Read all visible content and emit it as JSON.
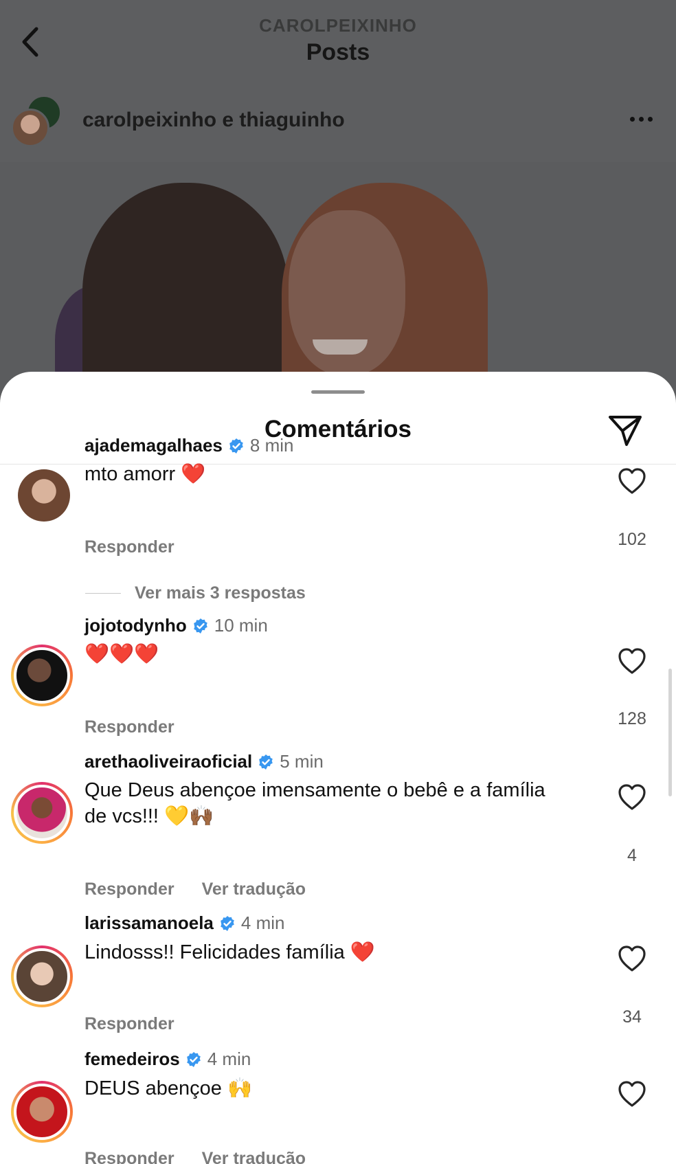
{
  "header": {
    "username": "CAROLPEIXINHO",
    "title": "Posts"
  },
  "post": {
    "authors": "carolpeixinho e thiaguinho"
  },
  "sheet": {
    "title": "Comentários"
  },
  "comments": [
    {
      "user": "ajademagalhaes",
      "time": "8 min",
      "text": "mto amorr",
      "emoji": "❤️",
      "reply_label": "Responder",
      "likes": "102",
      "more_replies": "Ver mais 3 respostas"
    },
    {
      "user": "jojotodynho",
      "time": "10 min",
      "text": "",
      "emoji": "❤️❤️❤️",
      "reply_label": "Responder",
      "likes": "128"
    },
    {
      "user": "arethaoliveiraoficial",
      "time": "5 min",
      "text": "Que Deus abençoe imensamente o bebê e a família de vcs!!!",
      "emoji": "💛🙌🏾",
      "reply_label": "Responder",
      "translate_label": "Ver tradução",
      "likes": "4"
    },
    {
      "user": "larissamanoela",
      "time": "4 min",
      "text": "Lindosss!! Felicidades família",
      "emoji": "❤️",
      "reply_label": "Responder",
      "likes": "34"
    },
    {
      "user": "femedeiros",
      "time": "4 min",
      "text": "DEUS abençoe",
      "emoji": "🙌",
      "reply_label": "Responder",
      "translate_label": "Ver tradução",
      "likes": ""
    }
  ],
  "colors": {
    "verified": "#3897f0",
    "heart": "#e0162b",
    "story_ring": "#e1306c"
  }
}
